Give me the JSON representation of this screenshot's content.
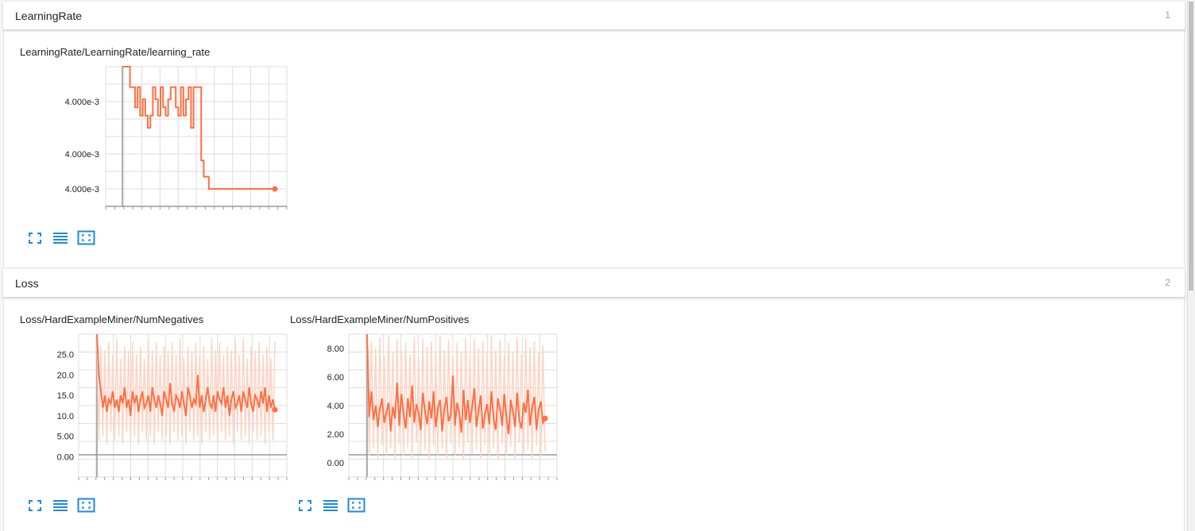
{
  "groups": [
    {
      "title": "LearningRate",
      "count": "1"
    },
    {
      "title": "Loss",
      "count": "2"
    }
  ],
  "cards": [
    {
      "title": "LearningRate/LearningRate/learning_rate"
    },
    {
      "title": "Loss/HardExampleMiner/NumNegatives"
    },
    {
      "title": "Loss/HardExampleMiner/NumPositives"
    }
  ],
  "buttons": {
    "fullscreen": "fullscreen-icon",
    "data_table": "list-icon",
    "fit_domain": "fit-domain-icon"
  },
  "colors": {
    "line": "#ff7043",
    "line_faint": "#ffd3c4",
    "grid": "#dddddd",
    "axis": "#999999",
    "icon": "#1e88e5"
  },
  "chart_data": [
    {
      "type": "line",
      "title": "LearningRate/LearningRate/learning_rate",
      "ytick_labels": [
        "4.000e-3",
        "4.000e-3",
        "4.000e-3"
      ],
      "series": [
        {
          "y": [
            5.0,
            5.0,
            5.0,
            4.5,
            4.5,
            4.0,
            4.5,
            3.8,
            4.2,
            3.8,
            3.5,
            3.8,
            4.5,
            4.2,
            3.8,
            4.5,
            4.0,
            3.8,
            4.2,
            4.5,
            4.5,
            4.0,
            3.8,
            4.5,
            3.8,
            4.2,
            4.5,
            3.5,
            4.5,
            4.5,
            4.5,
            2.7,
            2.3,
            2.3,
            2.0,
            2.0,
            2.0,
            2.0,
            2.0,
            2.0,
            2.0,
            2.0,
            2.0,
            2.0,
            2.0,
            2.0,
            2.0,
            2.0,
            2.0,
            2.0,
            2.0,
            2.0,
            2.0,
            2.0,
            2.0,
            2.0,
            2.0,
            2.0,
            2.0,
            2.0,
            2.0
          ]
        }
      ]
    },
    {
      "type": "line",
      "title": "Loss/HardExampleMiner/NumNegatives",
      "ylim": [
        -5,
        30
      ],
      "yticks": [
        "0.00",
        "5.00",
        "10.0",
        "15.0",
        "20.0",
        "25.0"
      ],
      "series": [
        {
          "name": "smoothed",
          "y": [
            30,
            20,
            16,
            12,
            15,
            11,
            14,
            13,
            16,
            12,
            14,
            11,
            15,
            13,
            17,
            12,
            14,
            10,
            16,
            13,
            15,
            11,
            14,
            16,
            12,
            13,
            15,
            11,
            17,
            14,
            12,
            15,
            13,
            10,
            16,
            14,
            12,
            18,
            13,
            11,
            15,
            14,
            12,
            16,
            13,
            10,
            17,
            15,
            12,
            14,
            13,
            20,
            12,
            15,
            11,
            14,
            17,
            13,
            12,
            15,
            11,
            16,
            14,
            13,
            17,
            12,
            15,
            10,
            14,
            16,
            12,
            13,
            15,
            11,
            16,
            14,
            12,
            17,
            13,
            11,
            15,
            14,
            12,
            16,
            13,
            17,
            11,
            15,
            12,
            14,
            11.5
          ]
        },
        {
          "name": "raw",
          "y": [
            30,
            4,
            27,
            5,
            26,
            3,
            28,
            6,
            25,
            4,
            29,
            5,
            24,
            3,
            27,
            6,
            26,
            4,
            28,
            5,
            25,
            3,
            27,
            6,
            24,
            4,
            29,
            5,
            26,
            3,
            28,
            6,
            25,
            4,
            27,
            5,
            26,
            3,
            28,
            6,
            25,
            4,
            29,
            5,
            24,
            3,
            27,
            6,
            26,
            4,
            28,
            5,
            25,
            3,
            27,
            6,
            24,
            4,
            29,
            5,
            26,
            3,
            28,
            6,
            25,
            4,
            27,
            5,
            26,
            3,
            28,
            6,
            25,
            4,
            29,
            5,
            24,
            3,
            27,
            6,
            26,
            4,
            28,
            5,
            25,
            3,
            27,
            6,
            24,
            4,
            28
          ]
        }
      ]
    },
    {
      "type": "line",
      "title": "Loss/HardExampleMiner/NumPositives",
      "ylim": [
        -1,
        9
      ],
      "yticks": [
        "0.00",
        "2.00",
        "4.00",
        "6.00",
        "8.00"
      ],
      "series": [
        {
          "name": "smoothed",
          "y": [
            9,
            3.2,
            5,
            3,
            4,
            2.5,
            3.8,
            4.5,
            2.8,
            3.5,
            4.2,
            2.2,
            3.9,
            3.1,
            5.6,
            2.6,
            4.8,
            3.4,
            2.4,
            4.5,
            3.2,
            5.4,
            2.8,
            4.1,
            3.5,
            2.3,
            4.9,
            3.6,
            2.7,
            4.3,
            3.1,
            5.0,
            2.5,
            3.8,
            4.4,
            2.2,
            3.7,
            4.6,
            2.9,
            3.3,
            6.1,
            2.6,
            4.2,
            3.5,
            2.1,
            5.1,
            3.0,
            4.4,
            2.8,
            3.9,
            5.2,
            2.5,
            3.6,
            4.7,
            2.4,
            3.4,
            4.1,
            2.7,
            5.0,
            3.1,
            2.3,
            4.5,
            3.8,
            2.6,
            4.8,
            3.2,
            2.0,
            4.4,
            3.6,
            2.5,
            4.9,
            3.0,
            2.4,
            4.2,
            3.5,
            5.1,
            2.6,
            3.9,
            4.6,
            2.3,
            3.7,
            4.3,
            2.8,
            3.1
          ]
        },
        {
          "name": "raw",
          "y": [
            9,
            0.5,
            8.5,
            1,
            8,
            0.3,
            8.8,
            1.2,
            7.5,
            0.4,
            8.9,
            1,
            7.8,
            0.2,
            8.6,
            1.3,
            7.9,
            0.5,
            8.4,
            1.1,
            7.6,
            0.3,
            8.8,
            1.4,
            7.4,
            0.6,
            8.7,
            0.9,
            8.1,
            0.2,
            8.5,
            1.2,
            7.7,
            0.4,
            8.9,
            1,
            7.9,
            0.3,
            8.6,
            1.3,
            7.5,
            0.5,
            8.4,
            1.1,
            7.8,
            0.2,
            8.8,
            1.4,
            7.6,
            0.6,
            8.7,
            0.9,
            8.0,
            0.3,
            8.5,
            1.2,
            7.7,
            0.4,
            8.9,
            1.0,
            7.9,
            0.2,
            8.6,
            1.3,
            7.5,
            0.5,
            8.4,
            1.1,
            7.8,
            0.3,
            8.8,
            1.4,
            7.6,
            0.6,
            8.7,
            0.9,
            8.1,
            0.2,
            8.5,
            1.2,
            7.7,
            0.4,
            8.2,
            0.8
          ]
        }
      ]
    }
  ]
}
